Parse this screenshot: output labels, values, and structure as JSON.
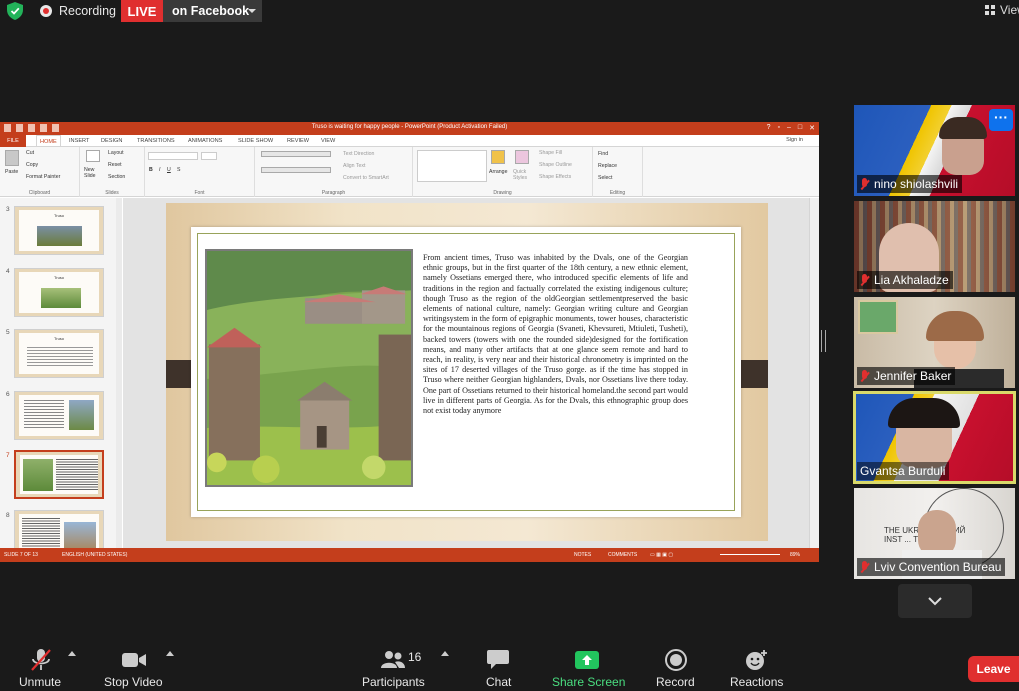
{
  "top_bar": {
    "recording_label": "Recording",
    "live_badge": "LIVE",
    "stream_target": "on Facebook",
    "view_label": "View"
  },
  "ppt": {
    "window_title": "Truso is waiting for happy people - PowerPoint (Product Activation Failed)",
    "ribbon_tabs": [
      "FILE",
      "HOME",
      "INSERT",
      "DESIGN",
      "TRANSITIONS",
      "ANIMATIONS",
      "SLIDE SHOW",
      "REVIEW",
      "VIEW"
    ],
    "sign_in": "Sign in",
    "groups": {
      "clipboard": "Clipboard",
      "slides": "Slides",
      "font": "Font",
      "paragraph": "Paragraph",
      "drawing": "Drawing",
      "editing": "Editing"
    },
    "commands": {
      "paste": "Paste",
      "cut": "Cut",
      "copy": "Copy",
      "format_painter": "Format Painter",
      "new_slide": "New Slide",
      "layout": "Layout",
      "reset": "Reset",
      "section": "Section",
      "text_direction": "Text Direction",
      "align_text": "Align Text",
      "convert_smartart": "Convert to SmartArt",
      "arrange": "Arrange",
      "quick_styles": "Quick Styles",
      "shape_fill": "Shape Fill",
      "shape_outline": "Shape Outline",
      "shape_effects": "Shape Effects",
      "find": "Find",
      "replace": "Replace",
      "select": "Select"
    },
    "thumbnails": [
      {
        "number": "3",
        "title": "Truso"
      },
      {
        "number": "4",
        "title": "Truso"
      },
      {
        "number": "5",
        "title": "Truso"
      },
      {
        "number": "6",
        "title": ""
      },
      {
        "number": "7",
        "title": ""
      },
      {
        "number": "8",
        "title": ""
      }
    ],
    "slide_text": "From ancient times, Truso was inhabited by the Dvals, one of the Georgian ethnic groups, but in the first quarter of the 18th century, a new ethnic element, namely Ossetians emerged there, who introduced specific elements of life and traditions in the region and factually correlated the existing indigenous culture; though Truso as the region of the oldGeorgian settlementpreserved the basic elements of national culture, namely: Georgian writing culture and Georgian writingsystem in the form of epigraphic monuments, tower houses, characteristic for the mountainous regions of Georgia (Svaneti, Khevsureti, Mtiuleti, Tusheti), backed towers (towers with one the rounded side)designed for the fortification means, and many other artifacts that at one glance seem remote and hard to reach, in reality, is very near and their historical chronometry is imprinted on the sites of 17 deserted villages of the Truso gorge. as if the time has stopped in Truso where neither Georgian highlanders, Dvals, nor Ossetians live there today. One part of Ossetians returned to their historical homeland.the second part would live in different parts of Georgia. As for the Dvals, this ethnographic group does not exist today anymore",
    "status_slide": "SLIDE 7 OF 13",
    "status_lang": "ENGLISH (UNITED STATES)",
    "status_notes": "NOTES",
    "status_comments": "COMMENTS",
    "zoom": "89%"
  },
  "participants": [
    {
      "name": "nino shiolashvili",
      "muted": true
    },
    {
      "name": "Lia Akhaladze",
      "muted": true
    },
    {
      "name": "Jennifer Baker",
      "muted": true
    },
    {
      "name": "Gvantsa Burduli",
      "muted": false
    },
    {
      "name": "Lviv Convention Bureau",
      "muted": true
    }
  ],
  "bottom_bar": {
    "unmute": "Unmute",
    "stop_video": "Stop Video",
    "participants": "Participants",
    "participants_count": "16",
    "chat": "Chat",
    "share_screen": "Share Screen",
    "record": "Record",
    "reactions": "Reactions",
    "leave": "Leave"
  },
  "colors": {
    "live_red": "#e02f2f",
    "ppt_orange": "#c43e1c",
    "share_green": "#22c55e",
    "zoom_blue": "#0e72ed",
    "speaker_outline": "#d9d96a"
  }
}
